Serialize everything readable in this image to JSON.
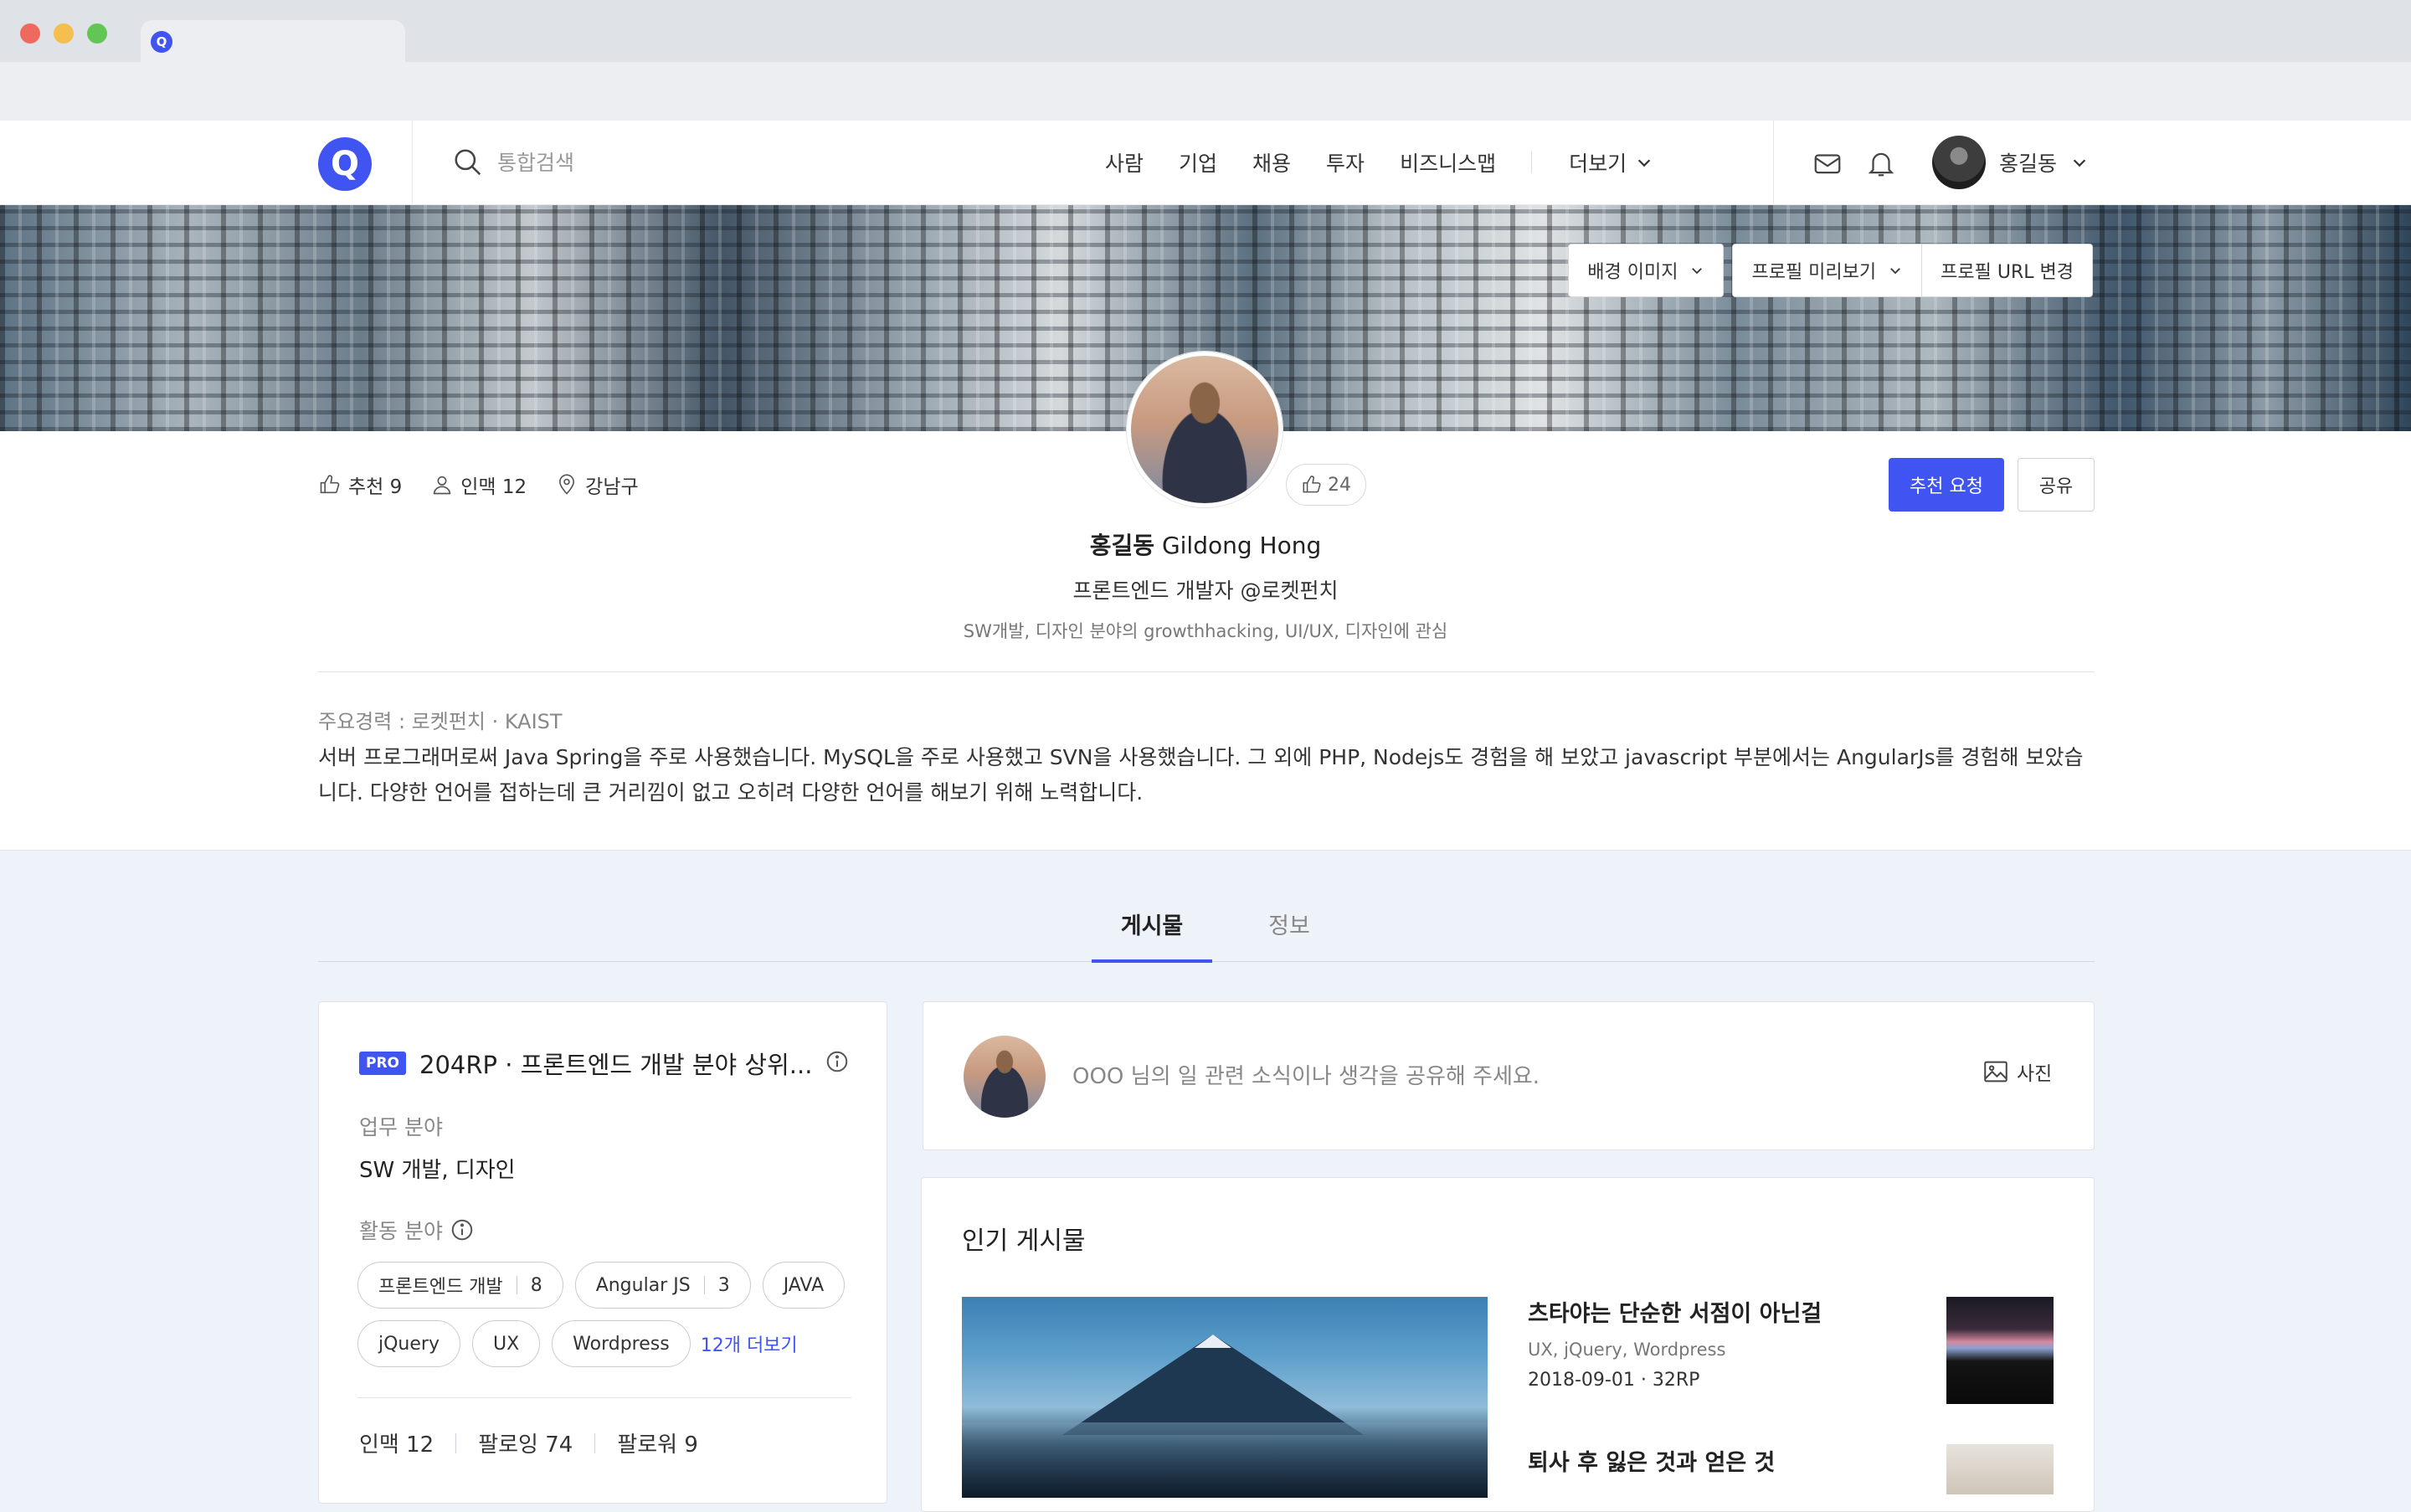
{
  "browser": {
    "favicon_label": "Q"
  },
  "header": {
    "logo_label": "Q",
    "search_placeholder": "통합검색",
    "nav": [
      "사람",
      "기업",
      "채용",
      "투자",
      "비즈니스맵"
    ],
    "more_label": "더보기",
    "user_name": "홍길동"
  },
  "banner": {
    "bg_image_label": "배경 이미지",
    "preview_label": "프로필 미리보기",
    "url_label": "프로필 URL 변경"
  },
  "profile": {
    "recommend_stat": "추천 9",
    "network_stat": "인맥 12",
    "location_stat": "강남구",
    "like_count": "24",
    "recommend_request_label": "추천 요청",
    "share_label": "공유",
    "name_ko": "홍길동",
    "name_en": "Gildong Hong",
    "title": "프론트엔드 개발자 @로켓펀치",
    "interest": "SW개발, 디자인 분야의 growthhacking, UI/UX, 디자인에 관심",
    "career_label": "주요경력 : 로켓펀치 · KAIST",
    "career_desc": "서버 프로그래머로써 Java Spring을 주로 사용했습니다. MySQL을 주로 사용했고 SVN을 사용했습니다. 그 외에 PHP, Nodejs도 경험을 해 보았고 javascript 부분에서는 AngularJs를 경험해 보았습니다. 다양한 언어를 접하는데 큰 거리낌이 없고 오히려 다양한 언어를 해보기 위해 노력합니다."
  },
  "tabs": {
    "posts": "게시물",
    "info": "정보"
  },
  "left_card": {
    "pro_badge": "PRO",
    "pro_title": "204RP · 프론트엔드 개발 분야 상위...",
    "work_field_label": "업무 분야",
    "work_field_value": "SW 개발, 디자인",
    "activity_label": "활동 분야",
    "tags": [
      {
        "name": "프론트엔드 개발",
        "count": "8"
      },
      {
        "name": "Angular JS",
        "count": "3"
      },
      {
        "name": "JAVA"
      },
      {
        "name": "jQuery"
      },
      {
        "name": "UX"
      },
      {
        "name": "Wordpress"
      }
    ],
    "more_tags": "12개 더보기",
    "network": "인맥 12",
    "following": "팔로잉 74",
    "followers": "팔로워 9"
  },
  "compose": {
    "placeholder": "OOO 님의 일 관련 소식이나 생각을 공유해 주세요.",
    "photo_label": "사진"
  },
  "popular": {
    "title": "인기 게시물",
    "posts": [
      {
        "title": "츠타야는 단순한 서점이 아닌걸",
        "tags": "UX, jQuery, Wordpress",
        "meta": "2018-09-01 · 32RP"
      },
      {
        "title": "퇴사 후 잃은 것과 얻은 것"
      }
    ]
  },
  "colors": {
    "accent": "#3f54f0"
  }
}
